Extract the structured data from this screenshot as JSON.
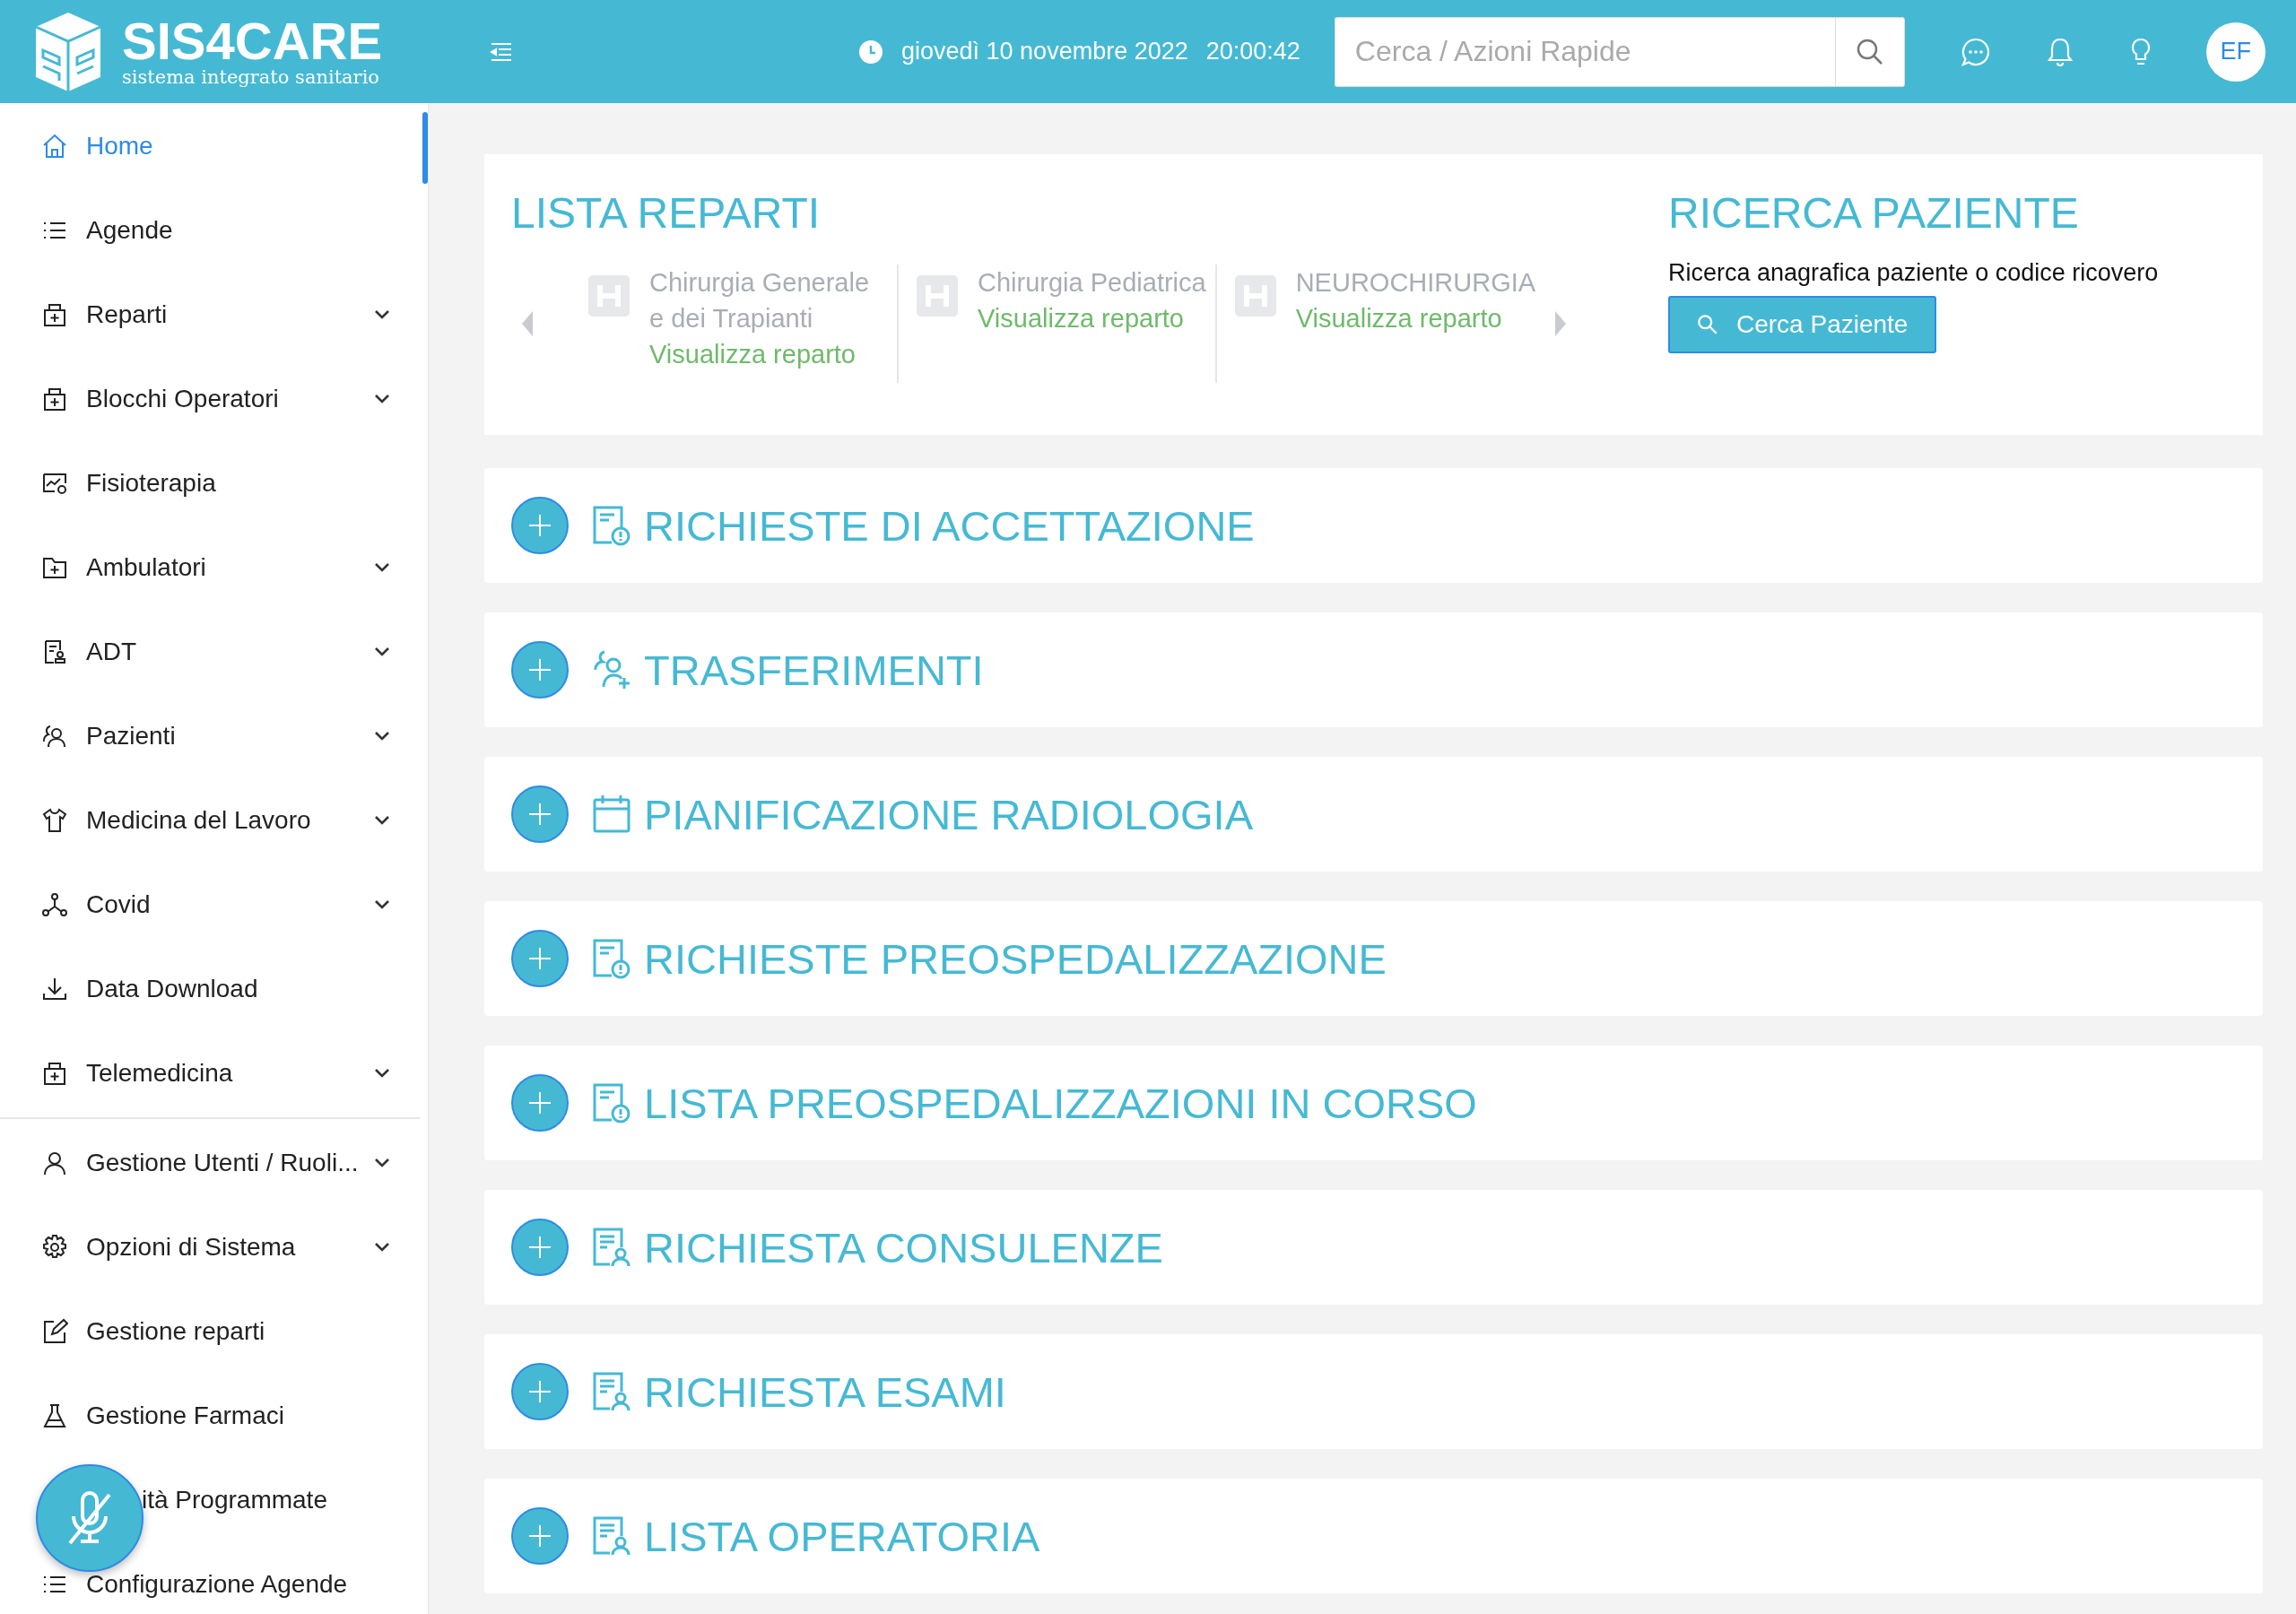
{
  "header": {
    "logo_title": "SIS4CARE",
    "logo_subtitle": "sistema integrato sanitario",
    "date": "giovedì 10 novembre 2022",
    "time": "20:00:42",
    "search": {
      "placeholder": "Cerca / Azioni Rapide"
    },
    "avatar": "EF"
  },
  "sidebar": {
    "items": [
      {
        "label": "Home",
        "selected": true,
        "submenu": false
      },
      {
        "label": "Agende",
        "selected": false,
        "submenu": false
      },
      {
        "label": "Reparti",
        "selected": false,
        "submenu": true
      },
      {
        "label": "Blocchi Operatori",
        "selected": false,
        "submenu": true
      },
      {
        "label": "Fisioterapia",
        "selected": false,
        "submenu": false
      },
      {
        "label": "Ambulatori",
        "selected": false,
        "submenu": true
      },
      {
        "label": "ADT",
        "selected": false,
        "submenu": true
      },
      {
        "label": "Pazienti",
        "selected": false,
        "submenu": true
      },
      {
        "label": "Medicina del Lavoro",
        "selected": false,
        "submenu": true
      },
      {
        "label": "Covid",
        "selected": false,
        "submenu": true
      },
      {
        "label": "Data Download",
        "selected": false,
        "submenu": false
      },
      {
        "label": "Telemedicina",
        "selected": false,
        "submenu": true
      }
    ],
    "admin_items": [
      {
        "label": "Gestione Utenti / Ruoli...",
        "selected": false,
        "submenu": true
      },
      {
        "label": "Opzioni di Sistema",
        "selected": false,
        "submenu": true
      },
      {
        "label": "Gestione reparti",
        "selected": false,
        "submenu": false
      },
      {
        "label": "Gestione Farmaci",
        "selected": false,
        "submenu": false
      },
      {
        "label": "ità Programmate",
        "selected": false,
        "submenu": false
      },
      {
        "label": "Configurazione Agende",
        "selected": false,
        "submenu": false
      }
    ]
  },
  "lista_reparti": {
    "title": "LISTA REPARTI",
    "items": [
      {
        "name": "Chirurgia Generale e dei Trapianti",
        "link": "Visualizza reparto"
      },
      {
        "name": "Chirurgia Pediatrica",
        "link": "Visualizza reparto"
      },
      {
        "name": "NEUROCHIRURGIA",
        "link": "Visualizza reparto"
      }
    ]
  },
  "ricerca_paziente": {
    "title": "RICERCA PAZIENTE",
    "description": "Ricerca anagrafica paziente o codice ricovero",
    "button": "Cerca Paziente"
  },
  "sections": [
    {
      "title": "RICHIESTE DI ACCETTAZIONE",
      "kind": "alert"
    },
    {
      "title": "TRASFERIMENTI",
      "kind": "people"
    },
    {
      "title": "PIANIFICAZIONE RADIOLOGIA",
      "kind": "calendar"
    },
    {
      "title": "RICHIESTE PREOSPEDALIZZAZIONE",
      "kind": "alert"
    },
    {
      "title": "LISTA PREOSPEDALIZZAZIONI IN CORSO",
      "kind": "alert"
    },
    {
      "title": "RICHIESTA CONSULENZE",
      "kind": "doc"
    },
    {
      "title": "RICHIESTA ESAMI",
      "kind": "doc"
    },
    {
      "title": "LISTA OPERATORIA",
      "kind": "doc"
    }
  ]
}
